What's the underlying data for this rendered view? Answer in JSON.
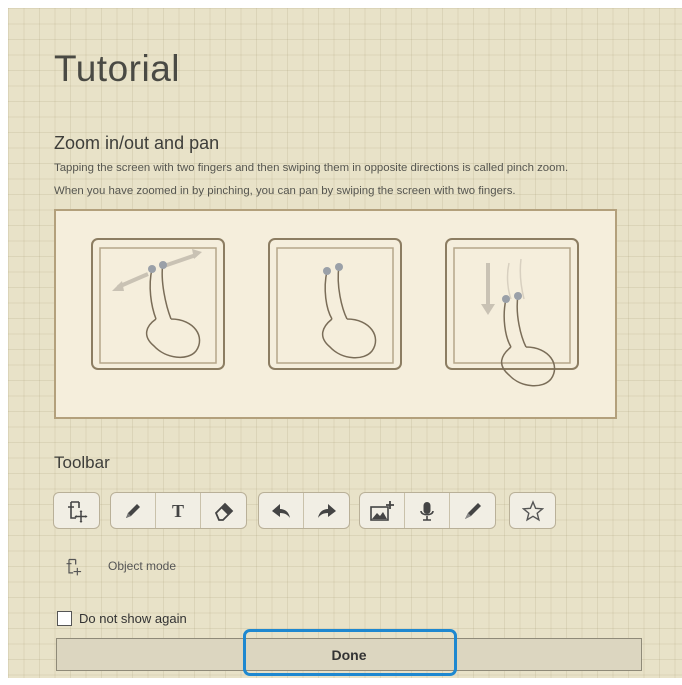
{
  "tutorial": {
    "title": "Tutorial",
    "section": {
      "title": "Zoom in/out and pan",
      "line1": "Tapping the screen with two fingers and then swiping them in opposite directions is called pinch zoom.",
      "line2": "When you have zoomed in by pinching, you can pan by swiping the screen with two fingers."
    },
    "toolbar": {
      "title": "Toolbar",
      "groups": [
        [
          "object-mode-icon"
        ],
        [
          "pen-icon",
          "text-icon",
          "eraser-icon"
        ],
        [
          "undo-icon",
          "redo-icon"
        ],
        [
          "insert-image-icon",
          "microphone-icon",
          "brush-icon"
        ],
        [
          "star-icon"
        ]
      ]
    },
    "legend": {
      "label": "Object mode"
    },
    "checkbox": {
      "label": "Do not show again",
      "checked": false
    },
    "done_label": "Done",
    "colors": {
      "highlight": "#1e88d0",
      "paper": "#e8e2c8"
    }
  }
}
